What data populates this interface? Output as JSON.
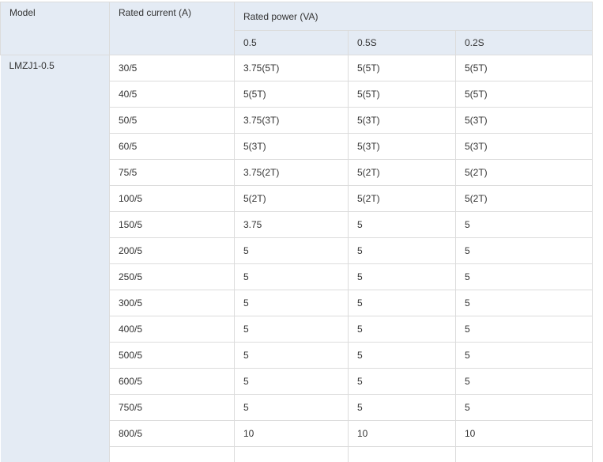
{
  "table": {
    "headers": {
      "model": "Model",
      "rated_current": "Rated current (A)",
      "rated_power": "Rated power (VA)",
      "accuracy_classes": [
        "0.5",
        "0.5S",
        "0.2S"
      ]
    },
    "model_value": "LMZJ1-0.5",
    "rows": [
      {
        "current": "30/5",
        "p05": "3.75(5T)",
        "p05s": "5(5T)",
        "p02s": "5(5T)"
      },
      {
        "current": "40/5",
        "p05": "5(5T)",
        "p05s": "5(5T)",
        "p02s": "5(5T)"
      },
      {
        "current": "50/5",
        "p05": "3.75(3T)",
        "p05s": "5(3T)",
        "p02s": "5(3T)"
      },
      {
        "current": "60/5",
        "p05": "5(3T)",
        "p05s": "5(3T)",
        "p02s": "5(3T)"
      },
      {
        "current": "75/5",
        "p05": "3.75(2T)",
        "p05s": "5(2T)",
        "p02s": "5(2T)"
      },
      {
        "current": "100/5",
        "p05": "5(2T)",
        "p05s": "5(2T)",
        "p02s": "5(2T)"
      },
      {
        "current": "150/5",
        "p05": "3.75",
        "p05s": "5",
        "p02s": "5"
      },
      {
        "current": "200/5",
        "p05": "5",
        "p05s": "5",
        "p02s": "5"
      },
      {
        "current": "250/5",
        "p05": "5",
        "p05s": "5",
        "p02s": "5"
      },
      {
        "current": "300/5",
        "p05": "5",
        "p05s": "5",
        "p02s": "5"
      },
      {
        "current": "400/5",
        "p05": "5",
        "p05s": "5",
        "p02s": "5"
      },
      {
        "current": "500/5",
        "p05": "5",
        "p05s": "5",
        "p02s": "5"
      },
      {
        "current": "600/5",
        "p05": "5",
        "p05s": "5",
        "p02s": "5"
      },
      {
        "current": "750/5",
        "p05": "5",
        "p05s": "5",
        "p02s": "5"
      },
      {
        "current": "800/5",
        "p05": "10",
        "p05s": "10",
        "p02s": "10"
      }
    ]
  }
}
